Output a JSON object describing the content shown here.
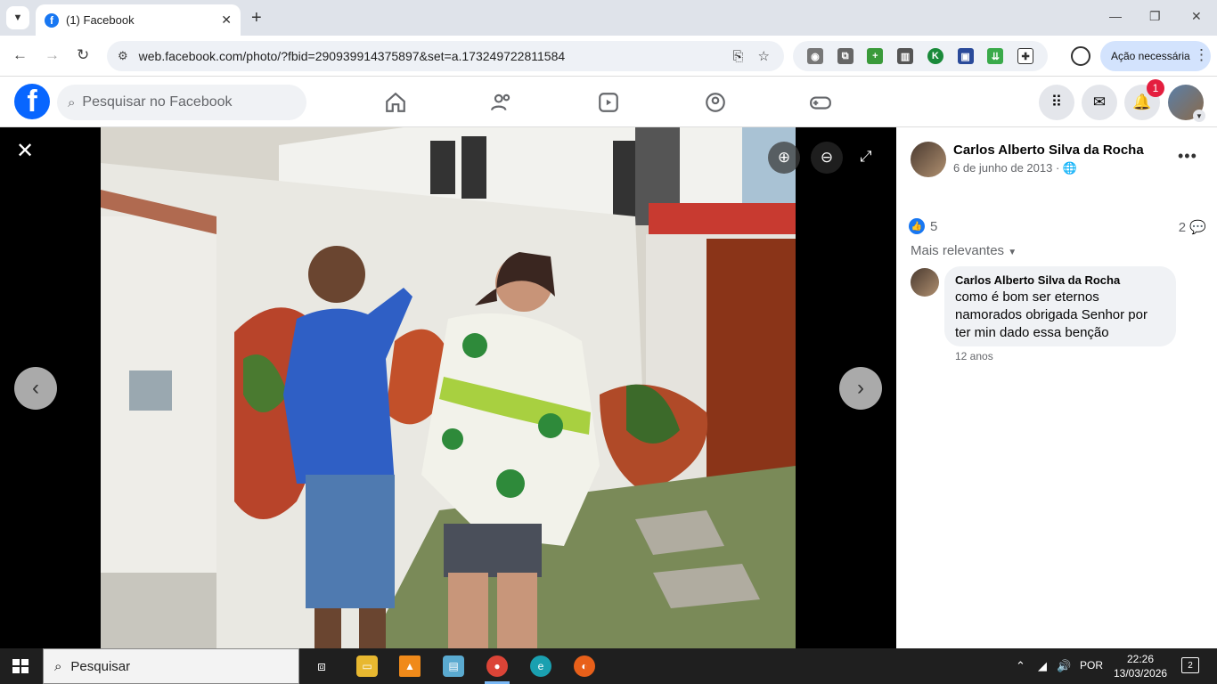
{
  "browser": {
    "tab_title": "(1) Facebook",
    "url": "web.facebook.com/photo/?fbid=290939914375897&set=a.173249722811584",
    "action_button": "Ação necessária"
  },
  "facebook": {
    "search_placeholder": "Pesquisar no Facebook",
    "notification_badge": "1"
  },
  "post": {
    "author": "Carlos Alberto Silva da Rocha",
    "date": "6 de junho de 2013",
    "date_separator": "·",
    "like_count": "5",
    "comment_count": "2",
    "sort_label": "Mais relevantes",
    "comments": [
      {
        "author": "Carlos Alberto Silva da Rocha",
        "text": "como é bom ser eternos namorados obrigada Senhor por ter min dado essa benção",
        "time": "12 anos"
      }
    ]
  },
  "taskbar": {
    "search_placeholder": "Pesquisar",
    "language": "POR",
    "time": "22:26",
    "date": "13/03/2026",
    "notification_count": "2"
  },
  "colors": {
    "facebook_blue": "#0866ff",
    "badge_red": "#e41e3f",
    "viewer_bg": "#000000"
  }
}
